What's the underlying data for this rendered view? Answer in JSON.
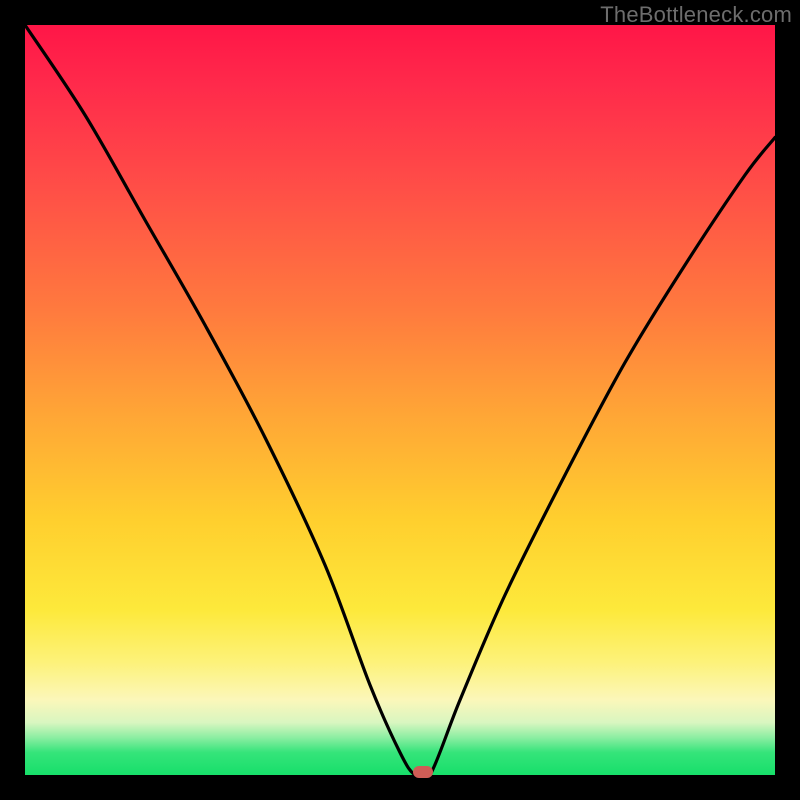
{
  "watermark": "TheBottleneck.com",
  "chart_data": {
    "type": "line",
    "title": "",
    "xlabel": "",
    "ylabel": "",
    "xlim": [
      0,
      100
    ],
    "ylim": [
      0,
      100
    ],
    "grid": false,
    "legend": false,
    "series": [
      {
        "name": "bottleneck-curve",
        "x": [
          0,
          8,
          16,
          24,
          32,
          40,
          46,
          50,
          52,
          54,
          58,
          64,
          72,
          80,
          88,
          96,
          100
        ],
        "values": [
          100,
          88,
          74,
          60,
          45,
          28,
          12,
          3,
          0,
          0,
          10,
          24,
          40,
          55,
          68,
          80,
          85
        ]
      }
    ],
    "marker": {
      "x_percent": 53,
      "y_percent": 0
    },
    "gradient_stops": [
      {
        "pos": 0,
        "color": "#ff1647"
      },
      {
        "pos": 22,
        "color": "#ff4f47"
      },
      {
        "pos": 52,
        "color": "#ffa636"
      },
      {
        "pos": 78,
        "color": "#fde93b"
      },
      {
        "pos": 90,
        "color": "#fbf7ba"
      },
      {
        "pos": 97,
        "color": "#35e47a"
      },
      {
        "pos": 100,
        "color": "#17df6a"
      }
    ]
  }
}
